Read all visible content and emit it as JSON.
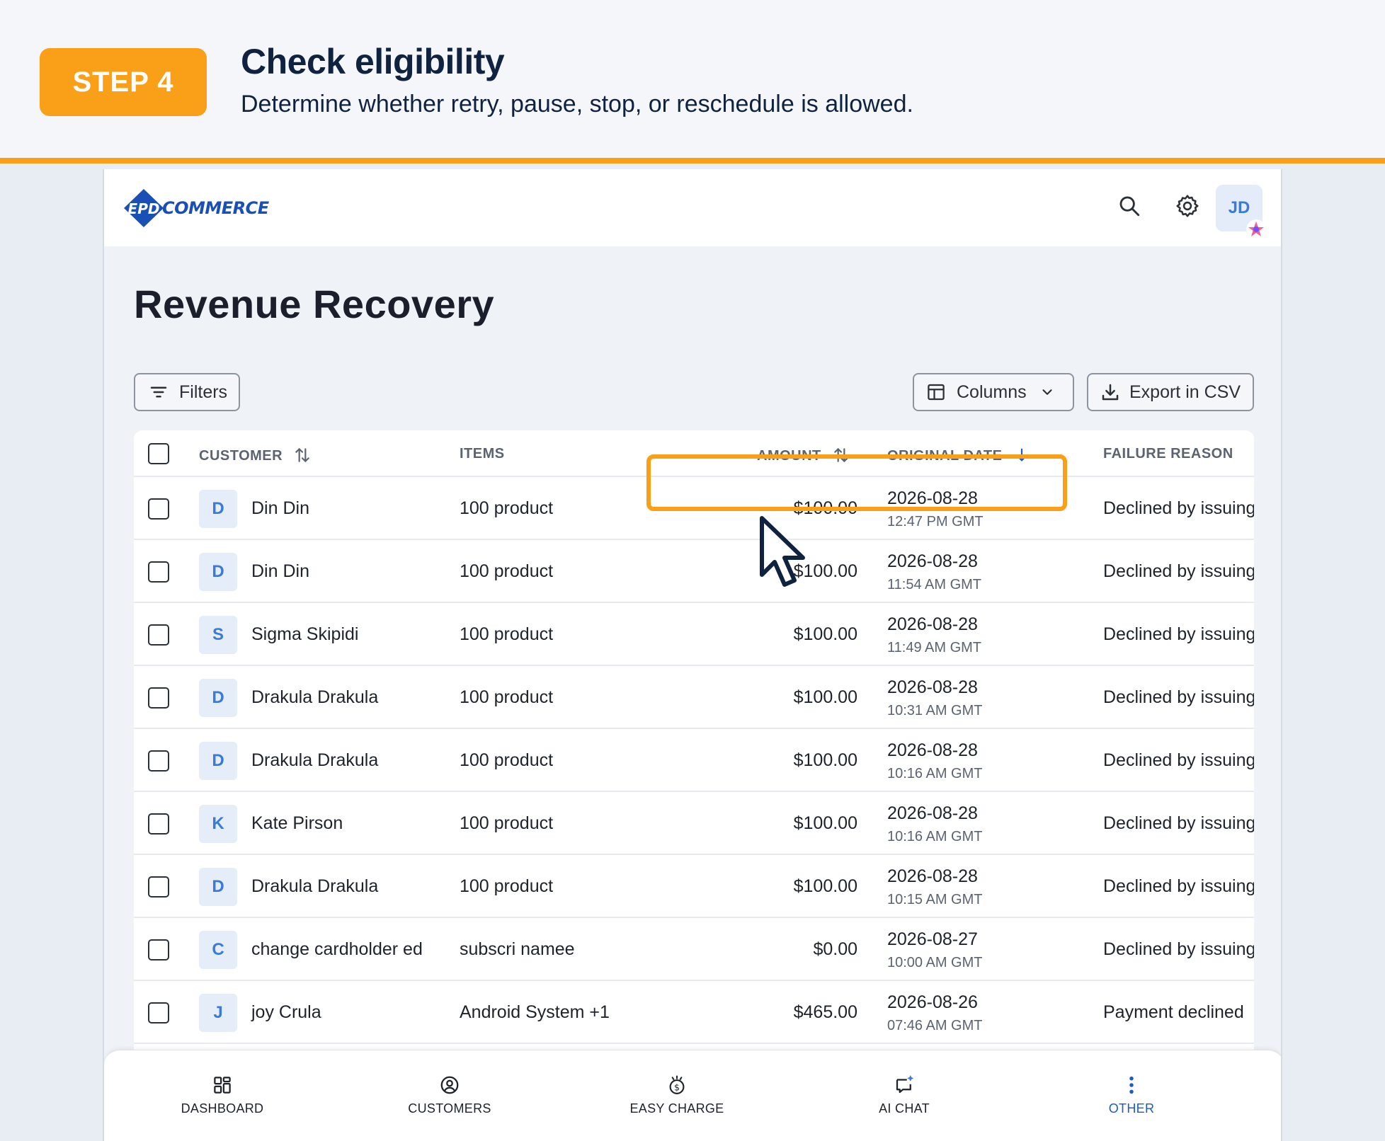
{
  "step": {
    "badge": "STEP 4",
    "title": "Check eligibility",
    "description": "Determine whether retry, pause, stop, or reschedule is allowed.",
    "accent_color": "#f9a018"
  },
  "app": {
    "logo_mark": "EPD",
    "logo_text": "COMMERCE",
    "user_initials": "JD",
    "icons": [
      "search-icon",
      "gear-icon",
      "avatar-badge-icon"
    ]
  },
  "page": {
    "title": "Revenue Recovery"
  },
  "toolbar": {
    "filters_label": "Filters",
    "columns_label": "Columns",
    "export_label": "Export in CSV"
  },
  "table": {
    "headers": {
      "customer": "CUSTOMER",
      "items": "ITEMS",
      "amount": "AMOUNT",
      "original_date": "ORIGINAL DATE",
      "failure_reason": "FAILURE REASON"
    },
    "rows": [
      {
        "initial": "D",
        "customer": "Din Din",
        "items": "100 product",
        "amount": "$100.00",
        "date": "2026-08-28",
        "time": "12:47 PM GMT",
        "reason": "Declined by issuing"
      },
      {
        "initial": "D",
        "customer": "Din Din",
        "items": "100 product",
        "amount": "$100.00",
        "date": "2026-08-28",
        "time": "11:54 AM GMT",
        "reason": "Declined by issuing"
      },
      {
        "initial": "S",
        "customer": "Sigma Skipidi",
        "items": "100 product",
        "amount": "$100.00",
        "date": "2026-08-28",
        "time": "11:49 AM GMT",
        "reason": "Declined by issuing"
      },
      {
        "initial": "D",
        "customer": "Drakula Drakula",
        "items": "100 product",
        "amount": "$100.00",
        "date": "2026-08-28",
        "time": "10:31 AM GMT",
        "reason": "Declined by issuing"
      },
      {
        "initial": "D",
        "customer": "Drakula Drakula",
        "items": "100 product",
        "amount": "$100.00",
        "date": "2026-08-28",
        "time": "10:16 AM GMT",
        "reason": "Declined by issuing"
      },
      {
        "initial": "K",
        "customer": "Kate Pirson",
        "items": "100 product",
        "amount": "$100.00",
        "date": "2026-08-28",
        "time": "10:16 AM GMT",
        "reason": "Declined by issuing"
      },
      {
        "initial": "D",
        "customer": "Drakula Drakula",
        "items": "100 product",
        "amount": "$100.00",
        "date": "2026-08-28",
        "time": "10:15 AM GMT",
        "reason": "Declined by issuing"
      },
      {
        "initial": "C",
        "customer": "change cardholder ed",
        "items": "subscri namee",
        "amount": "$0.00",
        "date": "2026-08-27",
        "time": "10:00 AM GMT",
        "reason": "Declined by issuing"
      },
      {
        "initial": "J",
        "customer": "joy Crula",
        "items": "Android System +1",
        "amount": "$465.00",
        "date": "2026-08-26",
        "time": "07:46 AM GMT",
        "reason": "Payment declined"
      }
    ]
  },
  "bottom_nav": {
    "items": [
      {
        "label": "DASHBOARD",
        "icon": "dashboard-icon",
        "active": false
      },
      {
        "label": "CUSTOMERS",
        "icon": "customers-icon",
        "active": false
      },
      {
        "label": "EASY CHARGE",
        "icon": "easy-charge-icon",
        "active": false
      },
      {
        "label": "AI CHAT",
        "icon": "ai-chat-icon",
        "active": false
      },
      {
        "label": "OTHER",
        "icon": "more-vertical-icon",
        "active": true
      }
    ],
    "active_color": "#1a5cc8"
  }
}
